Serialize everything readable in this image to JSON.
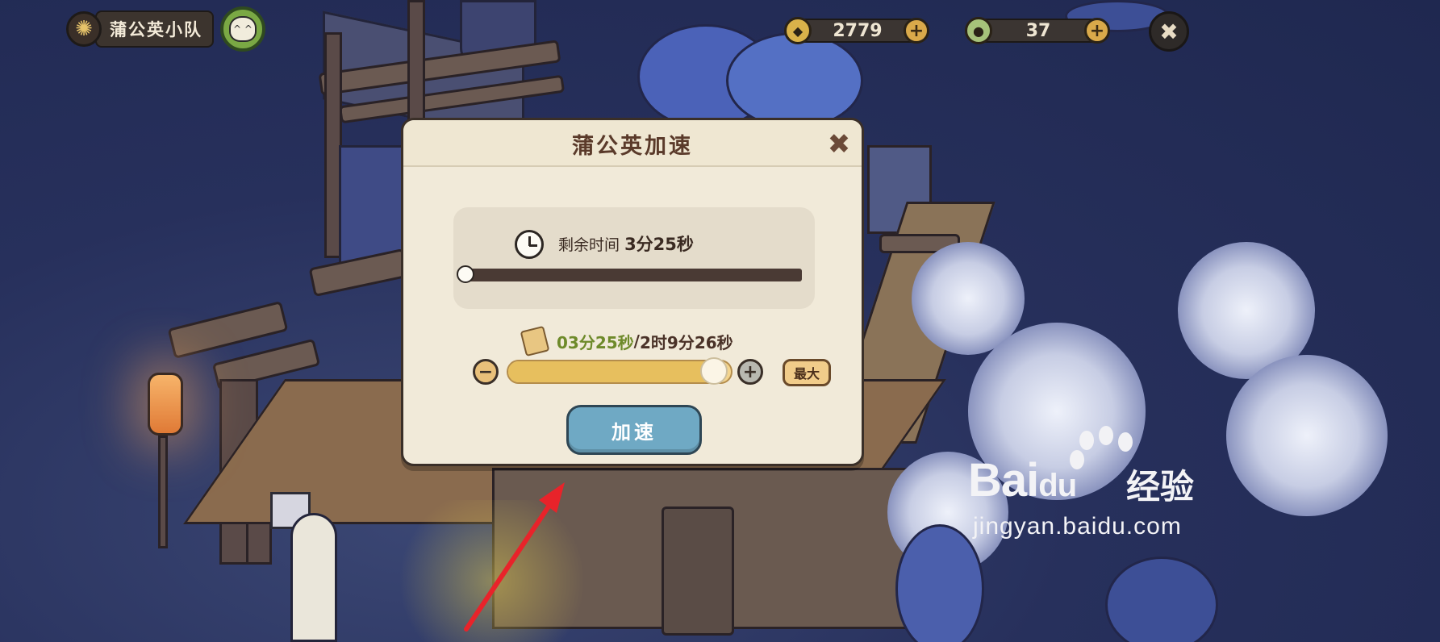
{
  "team": {
    "name": "蒲公英小队",
    "avatar_face": "^ ^"
  },
  "currencies": [
    {
      "icon": "coin-icon",
      "value": "2779"
    },
    {
      "icon": "seed-icon",
      "value": "37"
    }
  ],
  "icons": {
    "plus": "+",
    "minus": "−",
    "close": "✖"
  },
  "dialog": {
    "title": "蒲公英加速",
    "remaining_label": "剩余时间",
    "remaining_value": "3分25秒",
    "cost_current": "03分25秒",
    "cost_separator": "/",
    "cost_total": "2时9分26秒",
    "slider_fraction": 0.026,
    "max_label": "最大",
    "speed_label": "加速"
  },
  "watermark": {
    "brand": "Bai",
    "brand_du": "du",
    "cn": "经验",
    "url": "jingyan.baidu.com"
  },
  "colors": {
    "accent_green": "#6e8a2a",
    "button_blue": "#6fa9c4",
    "arrow_red": "#e8232a"
  }
}
